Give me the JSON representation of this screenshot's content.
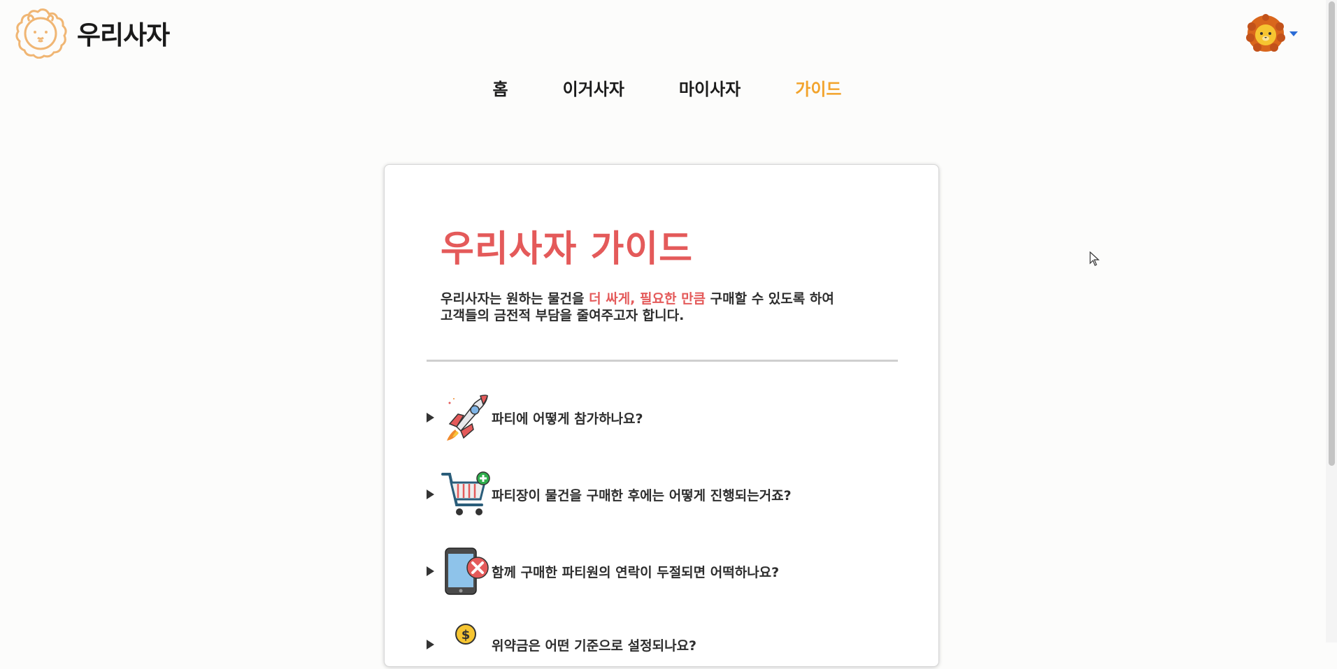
{
  "header": {
    "brand": "우리사자",
    "logo_icon": "lion-outline-icon",
    "avatar_icon": "lion-avatar-icon",
    "dropdown_icon": "caret-down-icon"
  },
  "nav": [
    {
      "label": "홈",
      "active": false
    },
    {
      "label": "이거사자",
      "active": false
    },
    {
      "label": "마이사자",
      "active": false
    },
    {
      "label": "가이드",
      "active": true
    }
  ],
  "guide": {
    "title": "우리사자 가이드",
    "desc_before": "우리사자는 원하는 물건을 ",
    "desc_highlight": "더 싸게, 필요한 만큼",
    "desc_after_line1": " 구매할 수 있도록 하여",
    "desc_line2": "고객들의 금전적 부담을 줄여주고자 합니다."
  },
  "faq": [
    {
      "question": "파티에 어떻게 참가하나요?",
      "icon": "rocket-icon"
    },
    {
      "question": "파티장이 물건을 구매한 후에는 어떻게 진행되는거죠?",
      "icon": "cart-add-icon"
    },
    {
      "question": "함께 구매한 파티원의 연락이 두절되면 어떡하나요?",
      "icon": "phone-blocked-icon"
    },
    {
      "question": "위약금은 어떤 기준으로 설정되나요?",
      "icon": "coin-icon"
    }
  ],
  "colors": {
    "accent": "#e45a5a",
    "nav_active": "#f2a32b",
    "logo_orange": "#f0b674"
  }
}
